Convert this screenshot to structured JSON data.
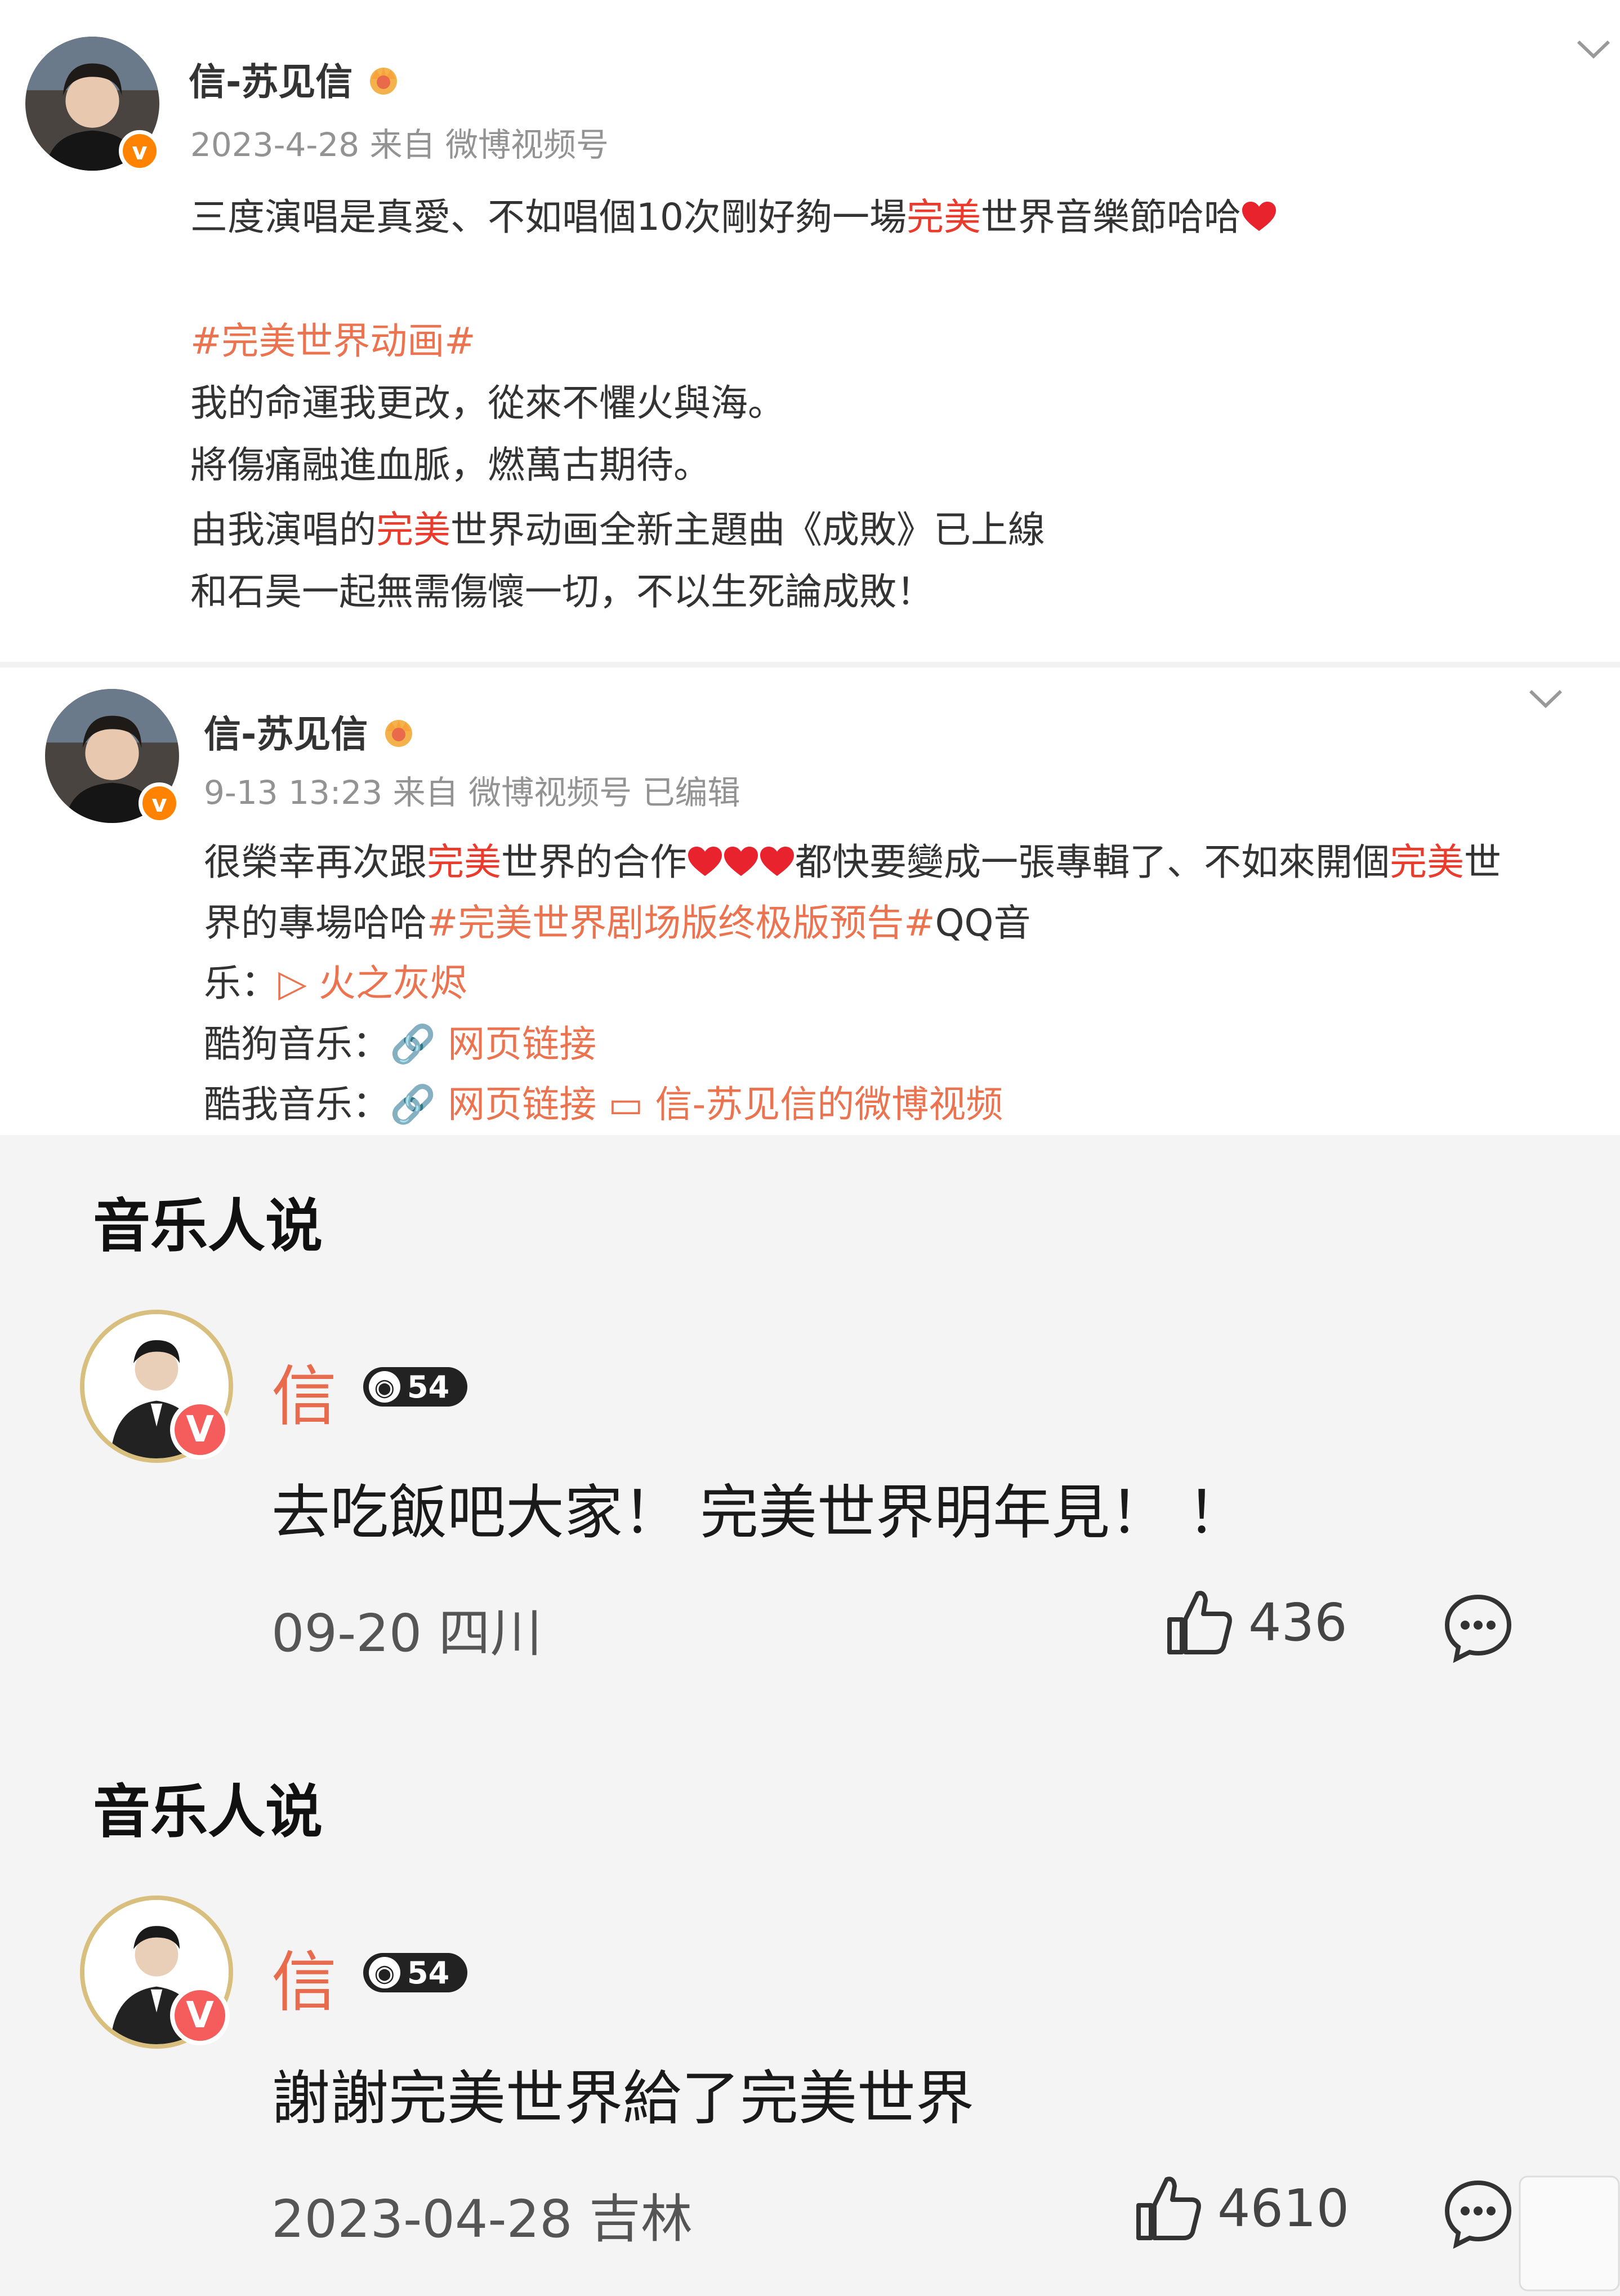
{
  "post1": {
    "username": "信-苏见信",
    "crown_icon": "crown-icon",
    "meta": "2023-4-28 来自 微博视频号",
    "lines": [
      {
        "parts": [
          {
            "t": "三度演唱是真愛、不如唱個10次剛好夠一場",
            "c": ""
          },
          {
            "t": "完美",
            "c": "hl"
          },
          {
            "t": "世界音樂節哈哈",
            "c": ""
          },
          {
            "icon": "heart"
          }
        ]
      },
      {
        "parts": [
          {
            "t": "#完美世界动画#",
            "c": "tag"
          }
        ]
      },
      {
        "parts": [
          {
            "t": "我的命運我更改，從來不懼火與海。",
            "c": ""
          }
        ]
      },
      {
        "parts": [
          {
            "t": "將傷痛融進血脈，燃萬古期待。",
            "c": ""
          }
        ]
      },
      {
        "parts": [
          {
            "t": "由我演唱的",
            "c": ""
          },
          {
            "t": "完美",
            "c": "hl"
          },
          {
            "t": "世界动画全新主題曲《成敗》已上線",
            "c": ""
          }
        ]
      },
      {
        "parts": [
          {
            "t": "和石昊一起無需傷懷一切，不以生死論成敗！",
            "c": ""
          }
        ]
      }
    ]
  },
  "post2": {
    "username": "信-苏见信",
    "meta": "9-13 13:23 来自 微博视频号 已编辑",
    "lines": [
      {
        "parts": [
          {
            "t": "很榮幸再次跟",
            "c": ""
          },
          {
            "t": "完美",
            "c": "hl"
          },
          {
            "t": "世界的合作",
            "c": ""
          },
          {
            "icon": "heart"
          },
          {
            "icon": "heart"
          },
          {
            "icon": "heart"
          },
          {
            "t": "都快要變成一張專輯了、不如來開個",
            "c": ""
          },
          {
            "t": "完美",
            "c": "hl"
          },
          {
            "t": "世",
            "c": ""
          }
        ]
      },
      {
        "parts": [
          {
            "t": "界的專場哈哈",
            "c": ""
          },
          {
            "t": "#完美世界剧场版终极版预告#",
            "c": "tag"
          },
          {
            "t": "QQ音",
            "c": ""
          }
        ]
      },
      {
        "parts": [
          {
            "t": "乐：",
            "c": ""
          },
          {
            "t": "▷ 火之灰烬",
            "c": "link"
          }
        ]
      },
      {
        "parts": [
          {
            "t": "酷狗音乐：",
            "c": ""
          },
          {
            "t": "🔗 网页链接",
            "c": "link"
          }
        ]
      },
      {
        "parts": [
          {
            "t": "酷我音乐：",
            "c": ""
          },
          {
            "t": "🔗 网页链接",
            "c": "link"
          },
          {
            "t": " ▭ 信-苏见信的微博视频",
            "c": "link"
          }
        ]
      }
    ]
  },
  "comments": [
    {
      "section_title": "音乐人说",
      "name": "信",
      "level": "54",
      "text": "去吃飯吧大家！ 完美世界明年見！ ！",
      "meta": "09-20 四川",
      "likes": "436"
    },
    {
      "section_title": "音乐人说",
      "name": "信",
      "level": "54",
      "text": "謝謝完美世界給了完美世界",
      "meta": "2023-04-28 吉林",
      "likes": "4610"
    }
  ],
  "colors": {
    "highlight": "#eb3b2d",
    "tag": "#eb7350",
    "verified": "#ff8200",
    "comment_name": "#e86b4d",
    "avatar_ring": "#d9bf7d"
  }
}
